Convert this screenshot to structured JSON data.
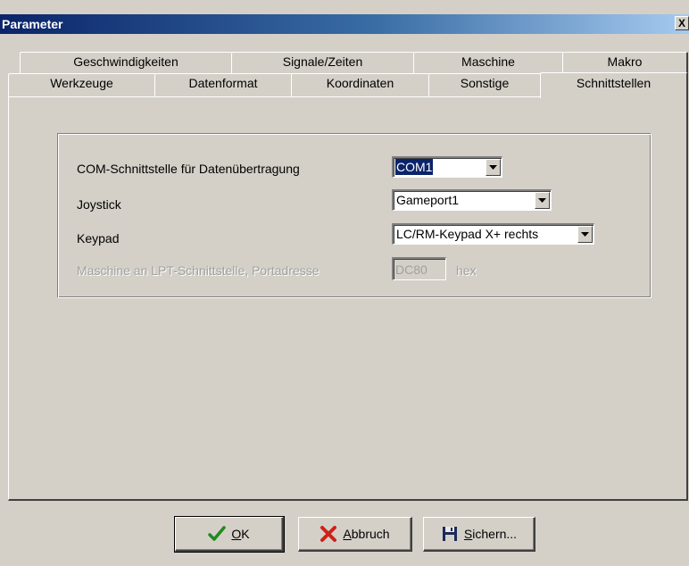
{
  "window": {
    "title": "Parameter",
    "close_glyph": "X"
  },
  "tabs": {
    "row_back": [
      {
        "label": "Geschwindigkeiten"
      },
      {
        "label": "Signale/Zeiten"
      },
      {
        "label": "Maschine"
      },
      {
        "label": "Makro"
      }
    ],
    "row_front": [
      {
        "label": "Werkzeuge"
      },
      {
        "label": "Datenformat"
      },
      {
        "label": "Koordinaten"
      },
      {
        "label": "Sonstige"
      },
      {
        "label": "Schnittstellen"
      }
    ],
    "active": "Schnittstellen"
  },
  "interfaces": {
    "com_label": "COM-Schnittstelle für Datenübertragung",
    "com_value": "COM1",
    "joystick_label": "Joystick",
    "joystick_value": "Gameport1",
    "keypad_label": "Keypad",
    "keypad_value": "LC/RM-Keypad X+ rechts",
    "lpt_label": "Maschine an LPT-Schnittstelle, Portadresse",
    "lpt_value": "DC80",
    "lpt_unit": "hex"
  },
  "buttons": {
    "ok": {
      "accel": "O",
      "rest": "K",
      "icon": "checkmark-icon"
    },
    "cancel": {
      "accel": "A",
      "rest": "bbruch",
      "icon": "red-x-icon"
    },
    "save": {
      "accel": "S",
      "rest": "ichern...",
      "icon": "floppy-disk-icon"
    }
  },
  "colors": {
    "title_start": "#0a246a",
    "title_end": "#a6caf0",
    "dialog_bg": "#d4d0c8",
    "selection": "#0a246a"
  }
}
